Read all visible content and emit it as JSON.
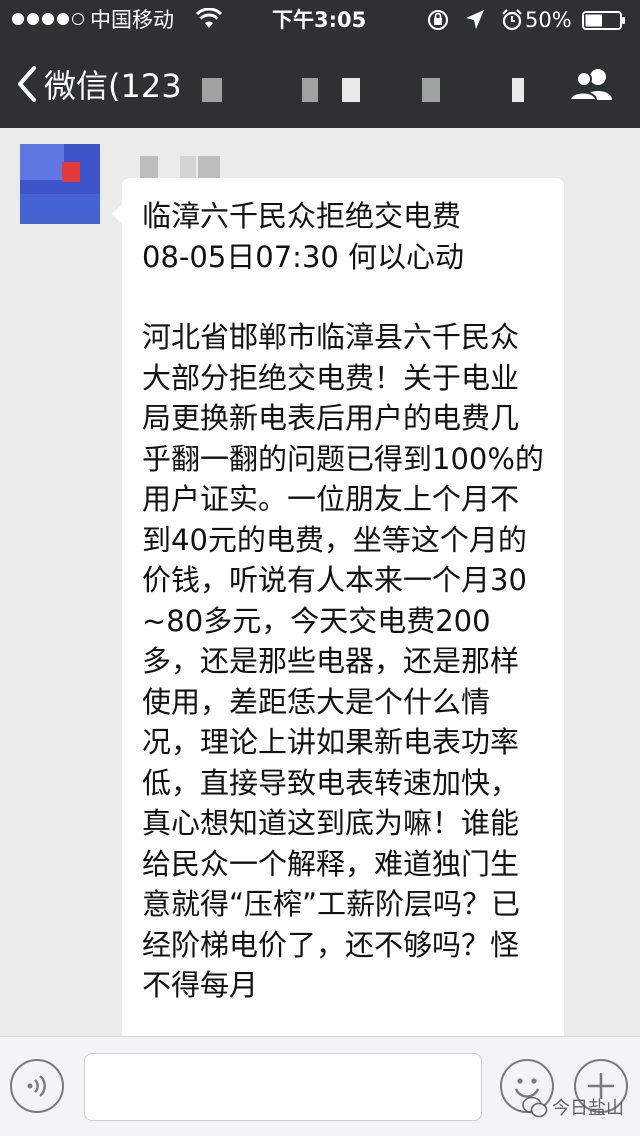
{
  "status_bar": {
    "carrier": "中国移动",
    "time": "下午3:05",
    "battery_percent": "50%",
    "battery_level": 0.5,
    "icons": [
      "signal-dots-icon",
      "wifi-icon",
      "rotation-lock-icon",
      "location-icon",
      "alarm-icon",
      "battery-icon"
    ]
  },
  "nav": {
    "back_label": "微信(123",
    "icons": [
      "chevron-left-icon",
      "contact-info-icon"
    ]
  },
  "message": {
    "title_line1": "临漳六千民众拒绝交电费",
    "title_line2": "08-05日07:30 何以心动",
    "body": "河北省邯郸市临漳县六千民众大部分拒绝交电费！关于电业局更换新电表后用户的电费几乎翻一翻的问题已得到100%的用户证实。一位朋友上个月不到40元的电费，坐等这个月的价钱，听说有人本来一个月30~80多元，今天交电费200多，还是那些电器，还是那样使用，差距恁大是个什么情况，理论上讲如果新电表功率低，直接导致电表转速加快，真心想知道这到底为嘛！谁能给民众一个解释，难道独门生意就得“压榨”工薪阶层吗？已经阶梯电价了，还不够吗？怪不得每月"
  },
  "input_bar": {
    "icons": [
      "voice-icon",
      "emoji-icon",
      "plus-icon"
    ]
  },
  "watermark": {
    "text": "今日盐山"
  },
  "colors": {
    "nav_background": "#2e3132",
    "chat_background": "#ebebeb",
    "bubble_background": "#ffffff",
    "text": "#111111"
  }
}
